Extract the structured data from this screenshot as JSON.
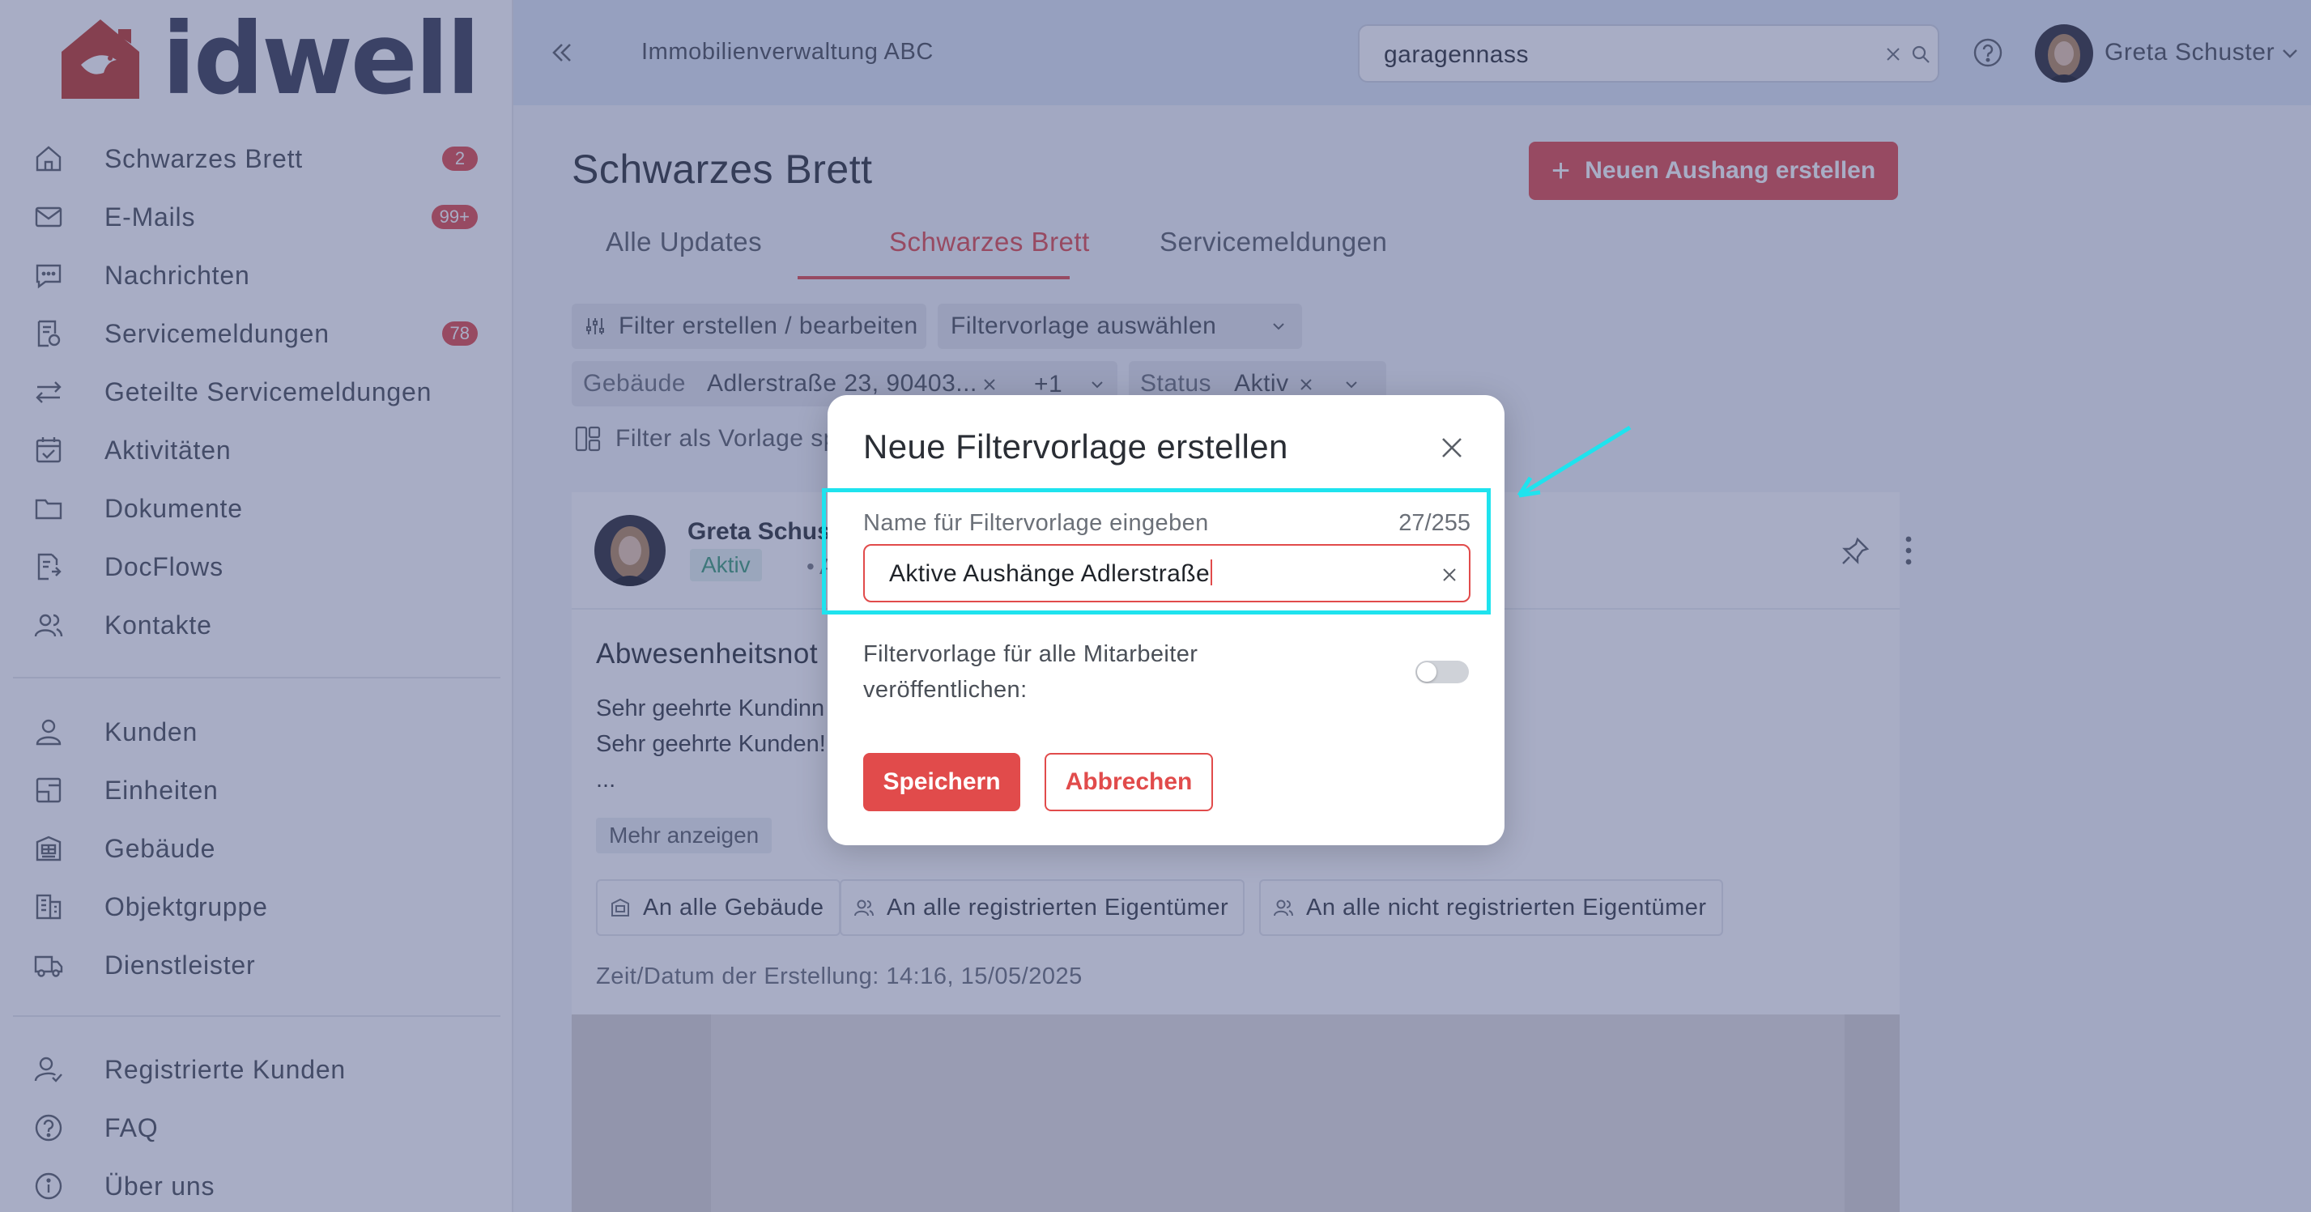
{
  "brand": {
    "name": "idwell"
  },
  "sidebar": {
    "items": [
      {
        "label": "Schwarzes Brett",
        "icon": "home-icon",
        "badge": "2"
      },
      {
        "label": "E-Mails",
        "icon": "mail-icon",
        "badge": "99+"
      },
      {
        "label": "Nachrichten",
        "icon": "chat-icon",
        "badge": ""
      },
      {
        "label": "Servicemeldungen",
        "icon": "service-icon",
        "badge": "78"
      },
      {
        "label": "Geteilte Servicemeldungen",
        "icon": "swap-icon",
        "badge": ""
      },
      {
        "label": "Aktivitäten",
        "icon": "calendar-check-icon",
        "badge": ""
      },
      {
        "label": "Dokumente",
        "icon": "folder-icon",
        "badge": ""
      },
      {
        "label": "DocFlows",
        "icon": "docflow-icon",
        "badge": ""
      },
      {
        "label": "Kontakte",
        "icon": "contacts-icon",
        "badge": ""
      }
    ],
    "items2": [
      {
        "label": "Kunden",
        "icon": "user-icon"
      },
      {
        "label": "Einheiten",
        "icon": "unit-icon"
      },
      {
        "label": "Gebäude",
        "icon": "building-icon"
      },
      {
        "label": "Objektgruppe",
        "icon": "object-group-icon"
      },
      {
        "label": "Dienstleister",
        "icon": "truck-icon"
      }
    ],
    "items3": [
      {
        "label": "Registrierte Kunden",
        "icon": "registered-user-icon"
      },
      {
        "label": "FAQ",
        "icon": "help-circle-icon"
      },
      {
        "label": "Über uns",
        "icon": "info-icon"
      }
    ]
  },
  "topbar": {
    "org_name": "Immobilienverwaltung ABC",
    "search_value": "garagennass",
    "user_name": "Greta Schuster"
  },
  "main": {
    "title": "Schwarzes Brett",
    "create_button": "Neuen Aushang erstellen",
    "tabs": [
      {
        "label": "Alle Updates"
      },
      {
        "label": "Schwarzes Brett"
      },
      {
        "label": "Servicemeldungen"
      }
    ],
    "filter_edit": "Filter erstellen / bearbeiten",
    "filter_template_select": "Filtervorlage auswählen",
    "filter_building_key": "Gebäude",
    "filter_building_value": "Adlerstraße 23, 90403...",
    "filter_building_more": "+1",
    "filter_status_key": "Status",
    "filter_status_value": "Aktiv",
    "save_as_template": "Filter als Vorlage speichern"
  },
  "post": {
    "author": "Greta Schuster",
    "status": "Aktiv",
    "audience": "• Aus",
    "title": "Abwesenheitsnot",
    "body_line1": "Sehr geehrte Kundinn",
    "body_line2": "Sehr geehrte Kunden!",
    "body_line3": "...",
    "more_label": "Mehr anzeigen",
    "chips": [
      {
        "label": "An alle Gebäude"
      },
      {
        "label": "An alle registrierten Eigentümer"
      },
      {
        "label": "An alle nicht registrierten Eigentümer"
      }
    ],
    "created_at": "Zeit/Datum der Erstellung: 14:16, 15/05/2025"
  },
  "dialog": {
    "title": "Neue Filtervorlage erstellen",
    "field_label": "Name für Filtervorlage eingeben",
    "char_count": "27/255",
    "field_value": "Aktive Aushänge Adlerstraße",
    "toggle_label": "Filtervorlage für alle Mitarbeiter veröffentlichen:",
    "toggle_on": false,
    "save_label": "Speichern",
    "cancel_label": "Abbrechen"
  },
  "colors": {
    "accent": "#e14b4b",
    "overlay": "#3f497e",
    "highlight": "#1ee3ee",
    "status_green": "#3f9e78"
  }
}
